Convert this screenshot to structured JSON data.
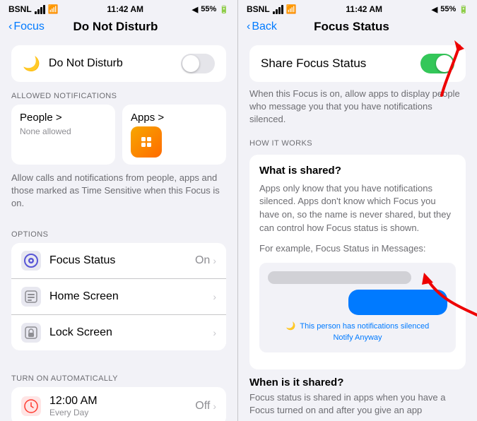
{
  "left_panel": {
    "status_bar": {
      "carrier": "BSNL",
      "time": "11:42 AM",
      "battery": "55%"
    },
    "nav": {
      "back_label": "Focus",
      "title": "Do Not Disturb"
    },
    "dnd_row": {
      "icon": "🌙",
      "label": "Do Not Disturb",
      "toggle_state": "off"
    },
    "allowed_section": {
      "header": "ALLOWED NOTIFICATIONS",
      "people": {
        "title": "People >",
        "subtitle": "None allowed"
      },
      "apps": {
        "title": "Apps >",
        "subtitle": ""
      }
    },
    "desc": "Allow calls and notifications from people, apps and those marked as Time Sensitive when this Focus is on.",
    "options_section": {
      "header": "OPTIONS",
      "items": [
        {
          "icon": "👁",
          "icon_bg": "#5856d6",
          "label": "Focus Status",
          "right": "On",
          "chevron": true
        },
        {
          "icon": "📱",
          "icon_bg": "#8e8e93",
          "label": "Home Screen",
          "right": "",
          "chevron": true
        },
        {
          "icon": "🔒",
          "icon_bg": "#8e8e93",
          "label": "Lock Screen",
          "right": "",
          "chevron": true
        }
      ]
    },
    "auto_section": {
      "header": "TURN ON AUTOMATICALLY",
      "items": [
        {
          "icon": "🕛",
          "icon_bg": "#ff3b30",
          "label": "12:00 AM",
          "sub": "Every Day",
          "right": "Off",
          "chevron": true
        }
      ]
    }
  },
  "right_panel": {
    "status_bar": {
      "carrier": "BSNL",
      "time": "11:42 AM",
      "battery": "55%"
    },
    "nav": {
      "back_label": "Back",
      "title": "Focus Status"
    },
    "share_row": {
      "label": "Share Focus Status",
      "toggle_state": "on"
    },
    "share_desc": "When this Focus is on, allow apps to display people who message you that you have notifications silenced.",
    "how_header": "HOW IT WORKS",
    "how_card": {
      "what_title": "What is shared?",
      "what_text": "Apps only know that you have notifications silenced. Apps don't know which Focus you have on, so the name is never shared, but they can control how Focus status is shown.",
      "example_text": "For example, Focus Status in Messages:",
      "msg_silenced": "This person has notifications silenced",
      "notify_anyway": "Notify Anyway"
    },
    "when_title": "When is it shared?",
    "when_text": "Focus status is shared in apps when you have a Focus turned on and after you give an app"
  }
}
